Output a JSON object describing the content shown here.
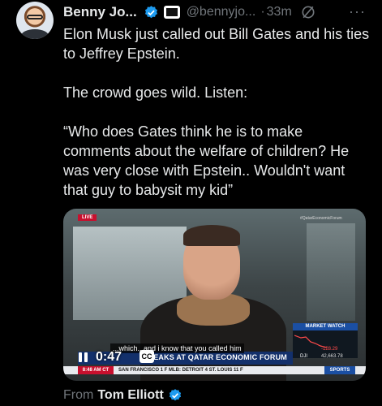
{
  "post": {
    "author_name": "Benny Jo...",
    "handle": "@bennyjo...",
    "separator": "·",
    "time": "33m",
    "more": "···",
    "paragraphs": [
      "Elon Musk just called out Bill Gates and his ties to Jeffrey Epstein.",
      "The crowd goes wild. Listen:",
      "“Who does Gates think he is to make comments about the welfare of children? He was very close with Epstein.. Wouldn't want that guy to babysit my kid”"
    ]
  },
  "video": {
    "live_badge": "LIVE",
    "corner_tag": "#QatarEconomicForum",
    "caption": "...which...and i know that you called him",
    "headline": "PEAKS AT QATAR ECONOMIC FORUM",
    "market_watch": "MARKET WATCH",
    "dji_label": "DJI",
    "dji_change": "-128.29",
    "dji_value": "42,663.78",
    "clock": "8:48 AM CT",
    "scores": "SAN FRANCISCO  1  F  MLB:  DETROIT  4  ST. LOUIS  11  F",
    "sports": "SPORTS",
    "duration": "0:47",
    "cc": "CC"
  },
  "attribution": {
    "prefix": "From",
    "source": "Tom Elliott"
  },
  "colors": {
    "background": "#000000",
    "text": "#e7e9ea",
    "muted": "#71767b",
    "verified_blue": "#1d9bf0",
    "lower_third_blue": "#13306b"
  },
  "icons": [
    "verified-badge-icon",
    "affiliate-badge-icon",
    "grok-icon",
    "more-icon",
    "pause-icon",
    "closed-captions-icon"
  ]
}
